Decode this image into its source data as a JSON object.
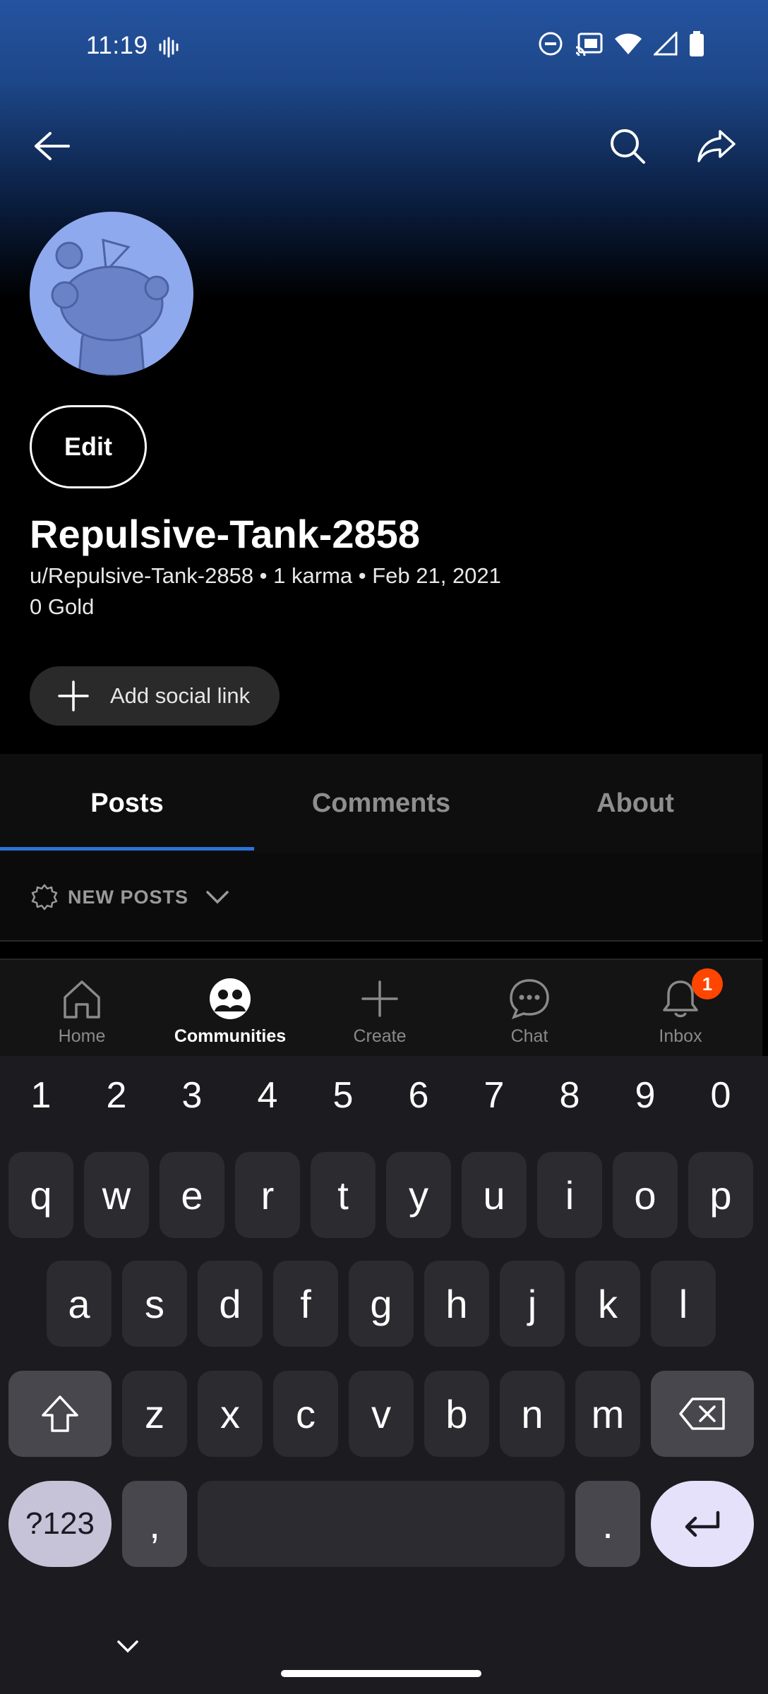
{
  "status_bar": {
    "time": "11:19"
  },
  "profile": {
    "edit_label": "Edit",
    "display_name": "Repulsive-Tank-2858",
    "meta": "u/Repulsive-Tank-2858 • 1 karma • Feb 21, 2021",
    "gold": "0 Gold",
    "add_social_label": "Add social link"
  },
  "tabs": [
    {
      "label": "Posts",
      "active": true
    },
    {
      "label": "Comments",
      "active": false
    },
    {
      "label": "About",
      "active": false
    }
  ],
  "sort": {
    "label": "NEW POSTS"
  },
  "bottom_nav": {
    "items": [
      {
        "label": "Home",
        "icon": "home-icon"
      },
      {
        "label": "Communities",
        "icon": "communities-icon",
        "active": true
      },
      {
        "label": "Create",
        "icon": "plus-icon"
      },
      {
        "label": "Chat",
        "icon": "chat-icon"
      },
      {
        "label": "Inbox",
        "icon": "bell-icon",
        "badge": "1"
      }
    ]
  },
  "keyboard": {
    "numbers": [
      "1",
      "2",
      "3",
      "4",
      "5",
      "6",
      "7",
      "8",
      "9",
      "0"
    ],
    "row1": [
      "q",
      "w",
      "e",
      "r",
      "t",
      "y",
      "u",
      "i",
      "o",
      "p"
    ],
    "row2": [
      "a",
      "s",
      "d",
      "f",
      "g",
      "h",
      "j",
      "k",
      "l"
    ],
    "row3": [
      "z",
      "x",
      "c",
      "v",
      "b",
      "n",
      "m"
    ],
    "symbols_label": "?123",
    "comma": ",",
    "period": "."
  },
  "colors": {
    "accent": "#2a73d9",
    "badge": "#ff4500",
    "avatar_bg": "#8fa9ee"
  }
}
